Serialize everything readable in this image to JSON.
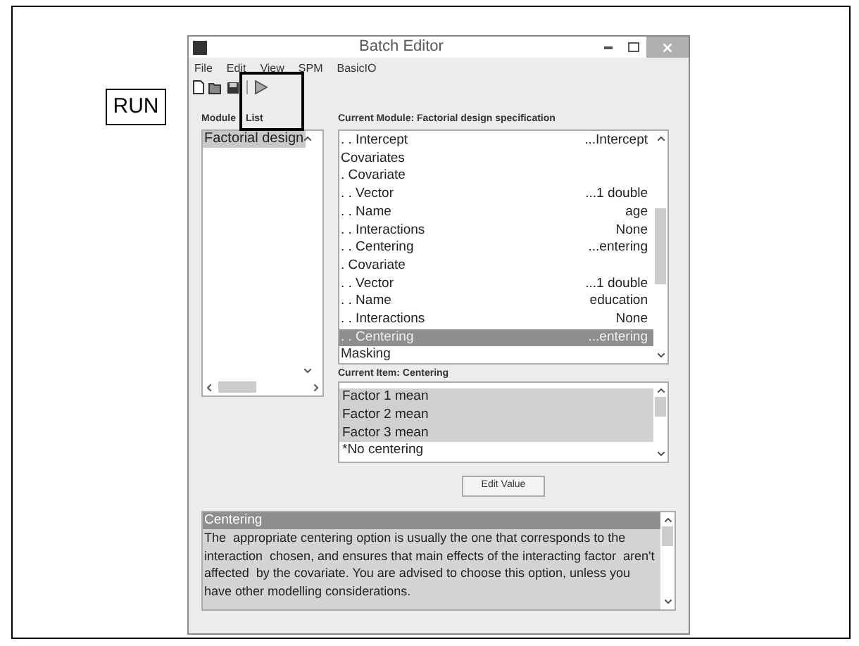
{
  "callout": "RUN",
  "window": {
    "title": "Batch Editor"
  },
  "menu": [
    "File",
    "Edit",
    "View",
    "SPM",
    "BasicIO"
  ],
  "module_list": {
    "label": "Module List",
    "items": [
      {
        "label": "Factorial design",
        "selected": true
      }
    ]
  },
  "current_module": {
    "label": "Current Module: Factorial design specification",
    "rows": [
      {
        "label": ". . Intercept",
        "value": "...Intercept",
        "selected": false
      },
      {
        "label": "Covariates",
        "selected": false
      },
      {
        "label": ". Covariate",
        "selected": false
      },
      {
        "label": ". . Vector",
        "value": "...1 double",
        "selected": false
      },
      {
        "label": ". . Name",
        "value": "age",
        "selected": false
      },
      {
        "label": ". . Interactions",
        "value": "None",
        "selected": false
      },
      {
        "label": ". . Centering",
        "value": "...entering",
        "selected": false
      },
      {
        "label": ". Covariate",
        "selected": false
      },
      {
        "label": ". . Vector",
        "value": "...1 double",
        "selected": false
      },
      {
        "label": ". . Name",
        "value": "education",
        "selected": false
      },
      {
        "label": ". . Interactions",
        "value": "None",
        "selected": false
      },
      {
        "label": ". . Centering",
        "value": "...entering",
        "selected": true
      },
      {
        "label": "Masking",
        "selected": false
      }
    ]
  },
  "current_item": {
    "label": "Current Item: Centering",
    "options": [
      {
        "label": "Factor 1 mean",
        "selected": true
      },
      {
        "label": "Factor 2 mean",
        "selected": true
      },
      {
        "label": "Factor 3 mean",
        "selected": true
      },
      {
        "label": "*No centering",
        "selected": false
      }
    ]
  },
  "edit_button": "Edit Value",
  "help": {
    "title": "Centering",
    "text": "The  appropriate centering option is usually the one that corresponds to the  interaction  chosen, and ensures that main effects of the interacting factor  aren't  affected  by the covariate. You are advised to choose this option, unless you have other modelling considerations."
  }
}
